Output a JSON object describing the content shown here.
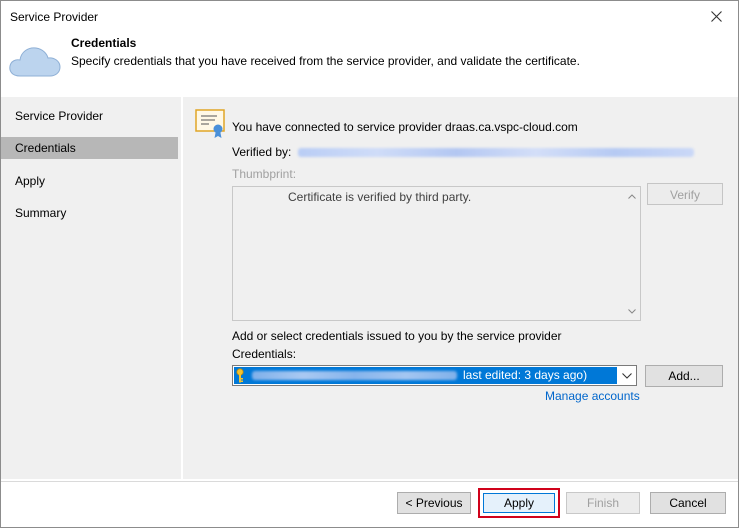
{
  "window": {
    "title": "Service Provider"
  },
  "header": {
    "title": "Credentials",
    "subtitle": "Specify credentials that you have received from the service provider, and validate the certificate."
  },
  "sidebar": {
    "items": [
      {
        "label": "Service Provider",
        "active": false
      },
      {
        "label": "Credentials",
        "active": true
      },
      {
        "label": "Apply",
        "active": false
      },
      {
        "label": "Summary",
        "active": false
      }
    ]
  },
  "content": {
    "connected_text": "You have connected to service provider draas.ca.vspc-cloud.com",
    "verified_label": "Verified by:",
    "thumbprint_label": "Thumbprint:",
    "thumbprint_text": "Certificate is verified by third party.",
    "verify_label": "Verify",
    "add_select_label": "Add or select credentials issued to you by the service provider",
    "credentials_label": "Credentials:",
    "credential_selected_suffix": "last edited: 3 days ago)",
    "add_label": "Add...",
    "manage_accounts_label": "Manage accounts"
  },
  "footer": {
    "previous_label": "< Previous",
    "apply_label": "Apply",
    "finish_label": "Finish",
    "cancel_label": "Cancel"
  },
  "icons": {
    "close": "close-icon",
    "cloud": "cloud-icon",
    "certificate": "certificate-icon",
    "key": "key-icon",
    "dropdown": "chevron-down-icon"
  },
  "colors": {
    "selection": "#0078d7",
    "link": "#0066cc",
    "highlight_border": "#d0021b",
    "sidebar_active": "#b7b7b7"
  }
}
